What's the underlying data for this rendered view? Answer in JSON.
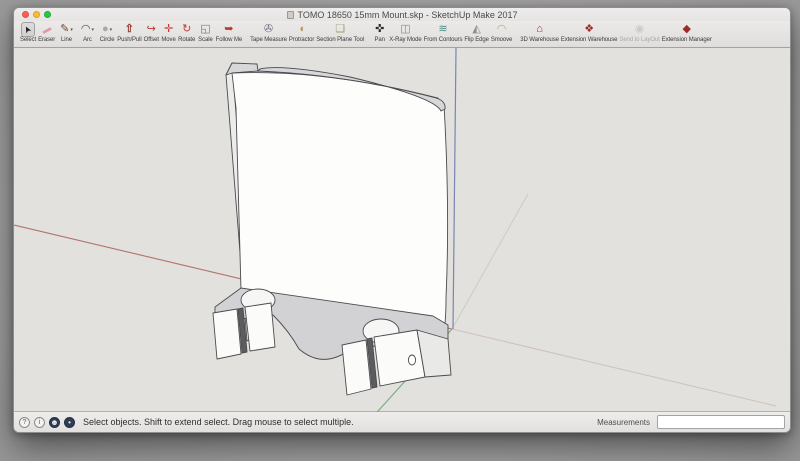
{
  "window": {
    "title": "TOMO 18650 15mm Mount.skp - SketchUp Make 2017",
    "traffic_lights": {
      "close": "#ff5f57",
      "minimize": "#febd2e",
      "zoom": "#28c840"
    }
  },
  "toolbar": {
    "tools": [
      {
        "label": "Select",
        "slug": "select",
        "glyph": "➤",
        "color": "#1c1c1c",
        "selected": true
      },
      {
        "label": "Eraser",
        "slug": "eraser",
        "glyph": "▬",
        "color": "#e098ae"
      },
      {
        "label": "Line",
        "slug": "line",
        "glyph": "✎",
        "color": "#6b4632",
        "dropdown": true
      },
      {
        "label": "Arc",
        "slug": "arc",
        "glyph": "◠",
        "color": "#4a4a4a",
        "dropdown": true
      },
      {
        "label": "Circle",
        "slug": "circle",
        "glyph": "●",
        "color": "#a9a99e",
        "dropdown": true
      },
      {
        "label": "Push/Pull",
        "slug": "push-pull",
        "glyph": "⇧",
        "color": "#93392f"
      },
      {
        "label": "Offset",
        "slug": "offset",
        "glyph": "↪",
        "color": "#b23a34"
      },
      {
        "label": "Move",
        "slug": "move",
        "glyph": "✛",
        "color": "#c23b35"
      },
      {
        "label": "Rotate",
        "slug": "rotate",
        "glyph": "↻",
        "color": "#c23b35"
      },
      {
        "label": "Scale",
        "slug": "scale",
        "glyph": "◱",
        "color": "#8a7752"
      },
      {
        "label": "Follow Me",
        "slug": "follow-me",
        "glyph": "➥",
        "color": "#b23a34"
      },
      {
        "label": "Tape Measure",
        "slug": "tape-measure",
        "glyph": "✇",
        "color": "#77688a",
        "group_start": true
      },
      {
        "label": "Protractor",
        "slug": "protractor",
        "glyph": "◖",
        "color": "#b3985e"
      },
      {
        "label": "Section Plane Tool",
        "slug": "section-plane-tool",
        "glyph": "❏",
        "color": "#98a06b"
      },
      {
        "label": "Pan",
        "slug": "pan",
        "glyph": "✜",
        "color": "#2b2b2b",
        "group_start": true
      },
      {
        "label": "X-Ray Mode",
        "slug": "x-ray-mode",
        "glyph": "◫",
        "color": "#7b8b9b"
      },
      {
        "label": "From Contours",
        "slug": "from-contours",
        "glyph": "≋",
        "color": "#4d8b84"
      },
      {
        "label": "Flip Edge",
        "slug": "flip-edge",
        "glyph": "◭",
        "color": "#8c8c94"
      },
      {
        "label": "Smoove",
        "slug": "smoove",
        "glyph": "◠",
        "color": "#c2a06e"
      },
      {
        "label": "3D Warehouse",
        "slug": "3d-warehouse",
        "glyph": "⌂",
        "color": "#a02a2a",
        "group_start": true
      },
      {
        "label": "Extension Warehouse",
        "slug": "extension-warehouse",
        "glyph": "❖",
        "color": "#a02a2a"
      },
      {
        "label": "Send to LayOut",
        "slug": "send-to-layout",
        "glyph": "◉",
        "color": "#b5b5b5",
        "disabled": true
      },
      {
        "label": "Extension Manager",
        "slug": "extension-manager",
        "glyph": "◆",
        "color": "#a02a2a"
      }
    ]
  },
  "viewport": {
    "axis_colors": {
      "red": "#b2716c",
      "red_faint": "#cfc0ba",
      "green": "#79a87a",
      "green_faint": "#c6cfc4",
      "blue": "#7787ad"
    }
  },
  "statusbar": {
    "help_icons": [
      {
        "slug": "help",
        "glyph": "?",
        "filled": false
      },
      {
        "slug": "instructor",
        "glyph": "i",
        "filled": false
      },
      {
        "slug": "account",
        "glyph": "☻",
        "filled": true
      },
      {
        "slug": "geolocation",
        "glyph": "•",
        "filled": true
      }
    ],
    "message": "Select objects. Shift to extend select. Drag mouse to select multiple.",
    "measurements_label": "Measurements",
    "measurements_value": ""
  }
}
